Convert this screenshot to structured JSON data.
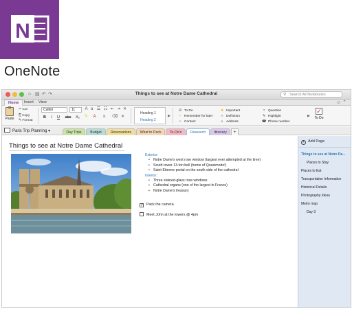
{
  "brand": {
    "name": "OneNote",
    "color": "#7a3a93",
    "logo_letter": "N"
  },
  "window": {
    "title": "Things to see at Notre Dame Cathedral",
    "search_placeholder": "Search All Notebooks",
    "menu_tabs": [
      "Home",
      "Insert",
      "View"
    ],
    "active_menu_tab": "Home"
  },
  "ribbon": {
    "paste": "Paste",
    "cut": "Cut",
    "copy": "Copy",
    "format": "Format",
    "font": "Calibri",
    "size": "11",
    "bold": "B",
    "italic": "I",
    "underline": "U",
    "strike": "abc",
    "subscript": "X₂",
    "styles": [
      "Heading 1",
      "Heading 2"
    ],
    "tags": [
      {
        "icon": "☑",
        "label": "To Do",
        "color": "#222"
      },
      {
        "icon": "★",
        "label": "Important",
        "color": "#e8a600"
      },
      {
        "icon": "?",
        "label": "Question",
        "color": "#7a3a93"
      },
      {
        "icon": "✓",
        "label": "Remember for later",
        "color": "#e8a600"
      },
      {
        "icon": "A",
        "label": "Definition",
        "color": "#4a9a3a"
      },
      {
        "icon": "✎",
        "label": "Highlight",
        "color": "#555"
      },
      {
        "icon": "☺",
        "label": "Contact",
        "color": "#2e75b6"
      },
      {
        "icon": "⌂",
        "label": "Address",
        "color": "#555"
      },
      {
        "icon": "☎",
        "label": "Phone number",
        "color": "#555"
      }
    ],
    "todo_button": "To Do"
  },
  "notebook": "Paris Trip Planning",
  "sections": [
    {
      "label": "Day Trips",
      "color": "#c9e3a6"
    },
    {
      "label": "Budget",
      "color": "#b7dcd6"
    },
    {
      "label": "Reservations",
      "color": "#f3df9c"
    },
    {
      "label": "What to Pack",
      "color": "#f6d7b3"
    },
    {
      "label": "To-Do's",
      "color": "#f4b9c2"
    },
    {
      "label": "Research",
      "color": "#bcd6ef"
    },
    {
      "label": "Itinerary",
      "color": "#dcc8ec"
    }
  ],
  "active_section": "Research",
  "page": {
    "title": "Things to see at Notre Dame Cathedral",
    "exterior_heading": "Exterior:",
    "exterior_items": [
      "Notre Dame's west rose window (largest ever attempted at the time)",
      "South tower 13-ton bell (home of Quasimodo!)",
      "Saint-Etienne portal on the south side of the cathedral"
    ],
    "interior_heading": "Interior:",
    "interior_items": [
      "Three stained-glass rose windows",
      "Cathedral organs (one of the largest in France)",
      "Notre Dame's treasury"
    ],
    "checkboxes": [
      {
        "label": "Pack the camera",
        "checked": true
      },
      {
        "label": "Meet John at the towers @ 4pm",
        "checked": false
      }
    ]
  },
  "pages_panel": {
    "add_page": "Add Page",
    "pages": [
      {
        "label": "Things to see at Notre Da...",
        "level": 0,
        "active": true
      },
      {
        "label": "Places to Stay",
        "level": 1,
        "active": false
      },
      {
        "label": "Places to Eat",
        "level": 0,
        "active": false
      },
      {
        "label": "Transportation Information",
        "level": 0,
        "active": false
      },
      {
        "label": "Historical Details",
        "level": 0,
        "active": false
      },
      {
        "label": "Photography Ideas",
        "level": 0,
        "active": false
      },
      {
        "label": "Metro map",
        "level": 0,
        "active": false
      },
      {
        "label": "Day 3",
        "level": 1,
        "active": false
      }
    ]
  }
}
